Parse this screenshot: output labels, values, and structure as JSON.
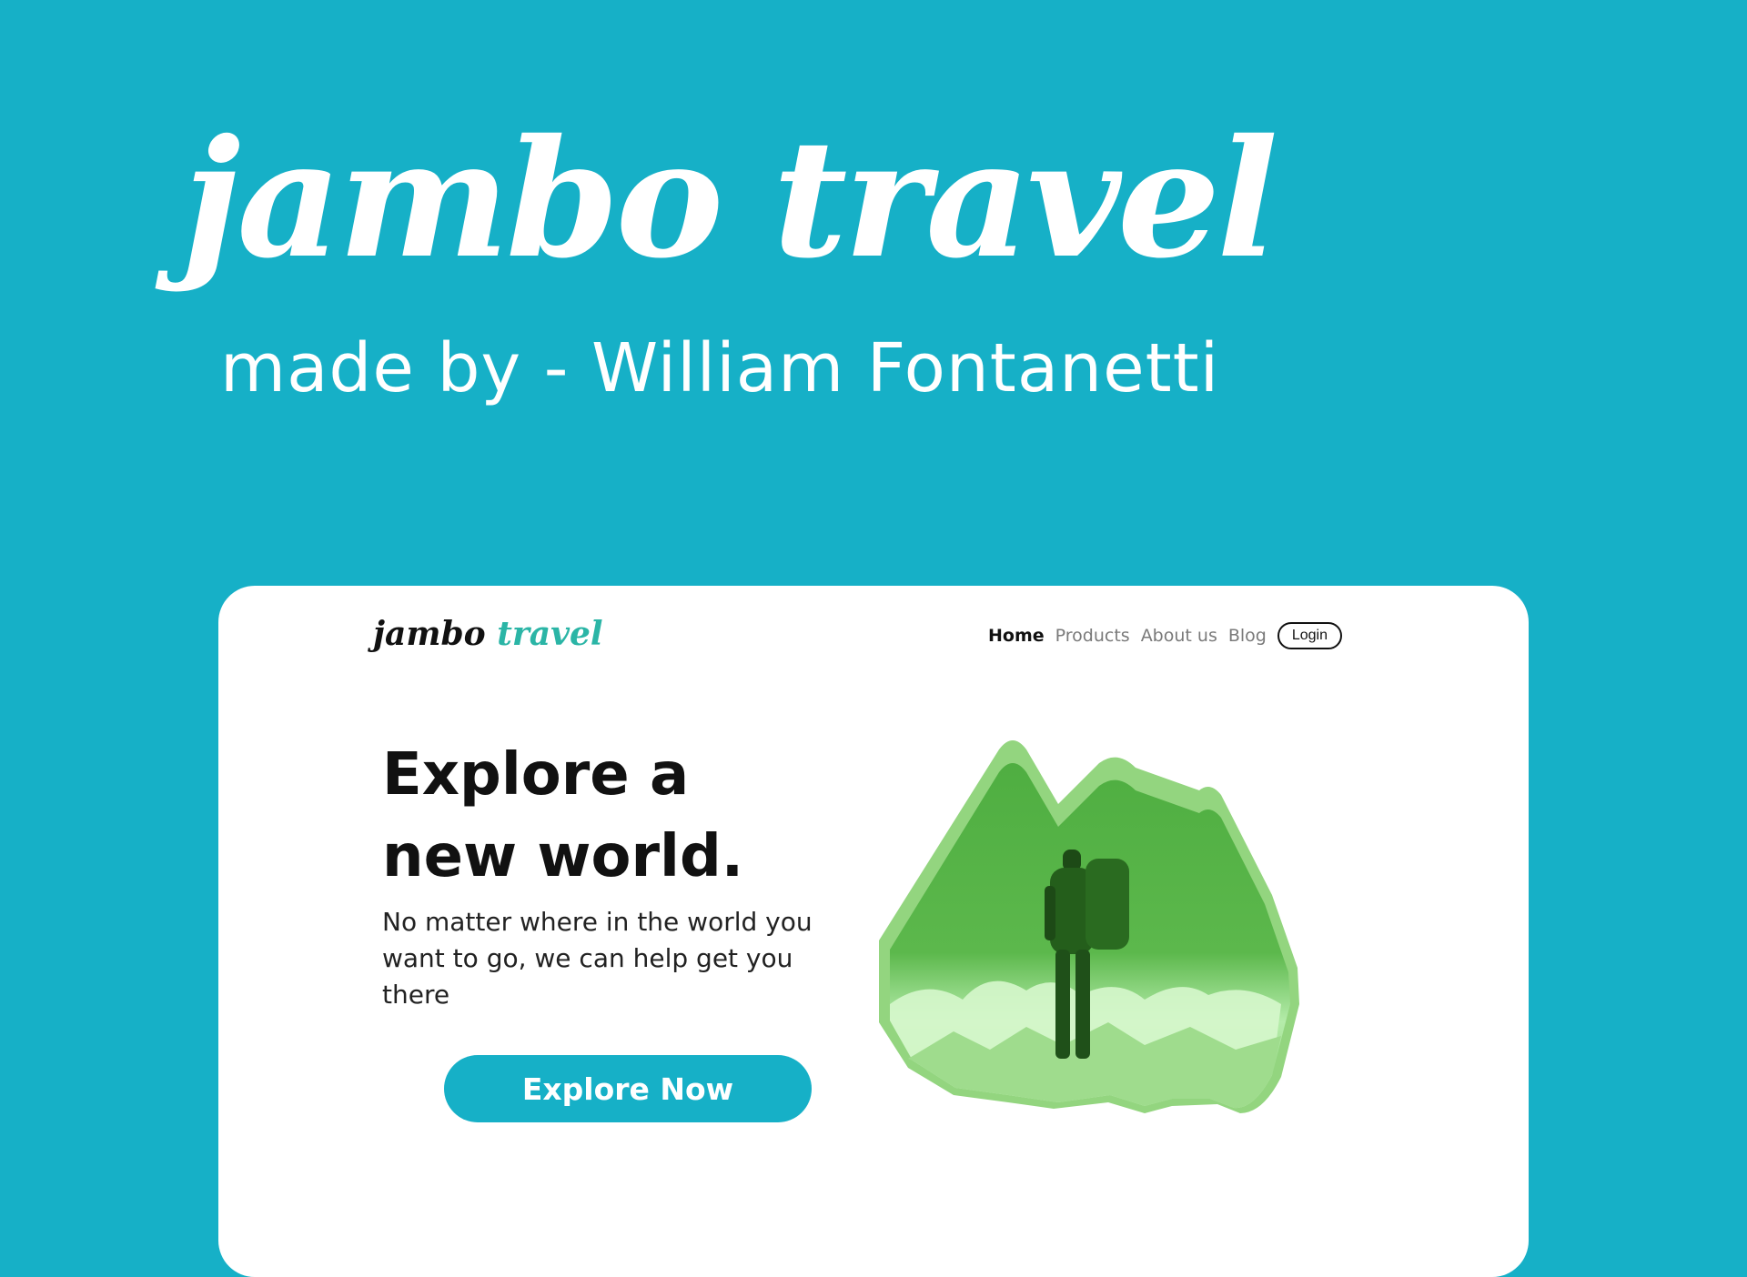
{
  "header": {
    "title": "jambo travel",
    "subtitle": "made by - William Fontanetti"
  },
  "preview": {
    "logo": {
      "word1": "jambo",
      "word2": "travel"
    },
    "nav": {
      "items": [
        "Home",
        "Products",
        "About us",
        "Blog"
      ],
      "active": "Home",
      "login_label": "Login"
    },
    "hero": {
      "headline_line1": "Explore a",
      "headline_line2": "new world.",
      "description": "No matter where in the world you want to go, we can help get you there",
      "cta_label": "Explore Now"
    },
    "image": {
      "icon_name": "hiker-mountains-illustration"
    }
  },
  "colors": {
    "background": "#16b0c7",
    "accent": "#16b0c7",
    "image_green": "#52b043",
    "image_light_green": "#90d47a",
    "logo_teal": "#2bb5a6"
  }
}
